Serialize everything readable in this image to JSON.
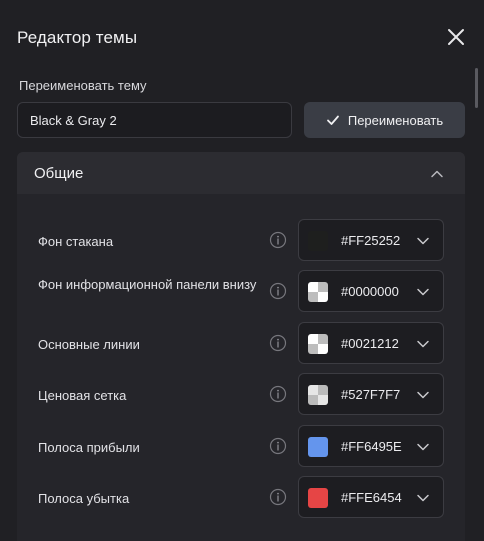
{
  "dialog": {
    "title": "Редактор темы"
  },
  "rename": {
    "label": "Переименовать тему",
    "value": "Black & Gray 2",
    "button_label": "Переименовать"
  },
  "section": {
    "title": "Общие",
    "expanded": true,
    "rows": [
      {
        "label": "Фон стакана",
        "hex": "#FF25252",
        "swatch": "#1e1f1e",
        "checker": false
      },
      {
        "label": "Фон информационной панели внизу",
        "hex": "#0000000",
        "swatch": "transparent",
        "checker": true
      },
      {
        "label": "Основные линии",
        "hex": "#0021212",
        "swatch": "transparent",
        "checker": true
      },
      {
        "label": "Ценовая сетка",
        "hex": "#527F7F7",
        "swatch": "#b8b8b8",
        "checker": true
      },
      {
        "label": "Полоса прибыли",
        "hex": "#FF6495E",
        "swatch": "#6495ed",
        "checker": false
      },
      {
        "label": "Полоса убытка",
        "hex": "#FFE6454",
        "swatch": "#e64545",
        "checker": false
      }
    ]
  },
  "icons": {
    "close": "close-icon",
    "check": "check-icon",
    "collapse": "chevron-up-icon",
    "info": "info-icon",
    "dropdown": "chevron-down-icon"
  }
}
